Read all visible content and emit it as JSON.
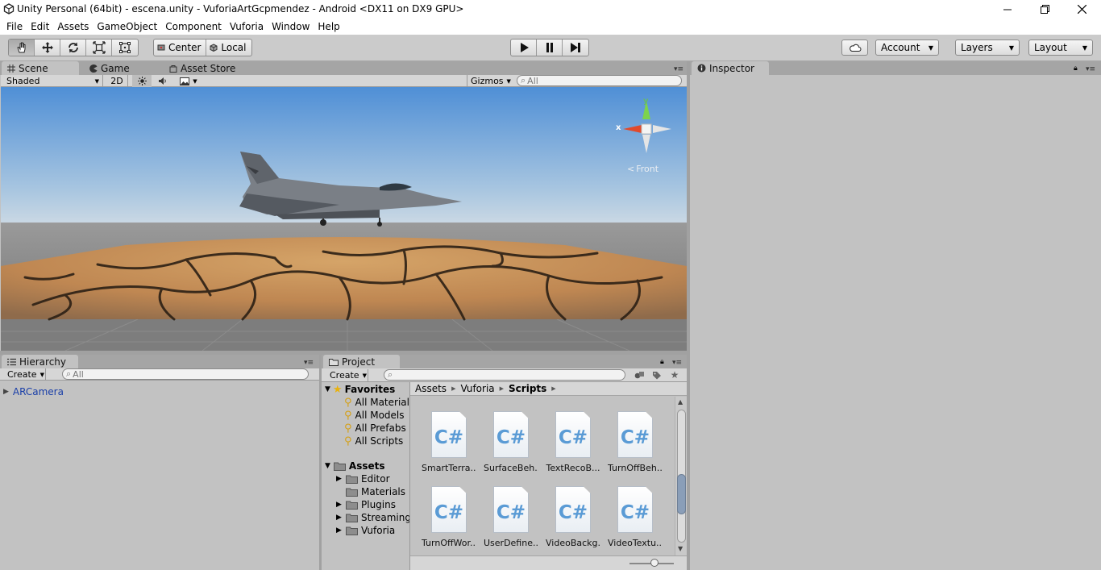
{
  "window": {
    "title": "Unity Personal (64bit) - escena.unity - VuforiaArtGcpmendez - Android <DX11 on DX9 GPU>"
  },
  "menu": [
    "File",
    "Edit",
    "Assets",
    "GameObject",
    "Component",
    "Vuforia",
    "Window",
    "Help"
  ],
  "toolbar": {
    "transform_tools": [
      "hand-icon",
      "move-icon",
      "rotate-icon",
      "scale-icon",
      "rect-tool-icon"
    ],
    "pivot_center": "Center",
    "pivot_local": "Local",
    "play_controls": [
      "play-icon",
      "pause-icon",
      "step-icon"
    ],
    "account": "Account",
    "layers": "Layers",
    "layout": "Layout"
  },
  "scene": {
    "tabs": [
      "Scene",
      "Game",
      "Asset Store"
    ],
    "shading": "Shaded",
    "mode_2d": "2D",
    "gizmos": "Gizmos",
    "search_placeholder": "All",
    "gizmo_labels": {
      "y": "y",
      "x": "x",
      "view": "Front"
    }
  },
  "inspector": {
    "tab": "Inspector"
  },
  "hierarchy": {
    "tab": "Hierarchy",
    "create": "Create",
    "search_placeholder": "All",
    "items": [
      "ARCamera"
    ]
  },
  "project": {
    "tab": "Project",
    "create": "Create",
    "favorites_label": "Favorites",
    "favorites": [
      "All Materials",
      "All Models",
      "All Prefabs",
      "All Scripts"
    ],
    "assets_label": "Assets",
    "folders": [
      {
        "name": "Editor",
        "expandable": true
      },
      {
        "name": "Materials",
        "expandable": false
      },
      {
        "name": "Plugins",
        "expandable": true
      },
      {
        "name": "StreamingAssets",
        "expandable": true
      },
      {
        "name": "Vuforia",
        "expandable": true
      }
    ],
    "breadcrumb": [
      "Assets",
      "Vuforia",
      "Scripts"
    ],
    "files": [
      "SmartTerra...",
      "SurfaceBeh...",
      "TextRecoB...",
      "TurnOffBeh...",
      "TurnOffWor...",
      "UserDefine...",
      "VideoBackg...",
      "VideoTextu..."
    ],
    "file_icon_text": "C#"
  }
}
